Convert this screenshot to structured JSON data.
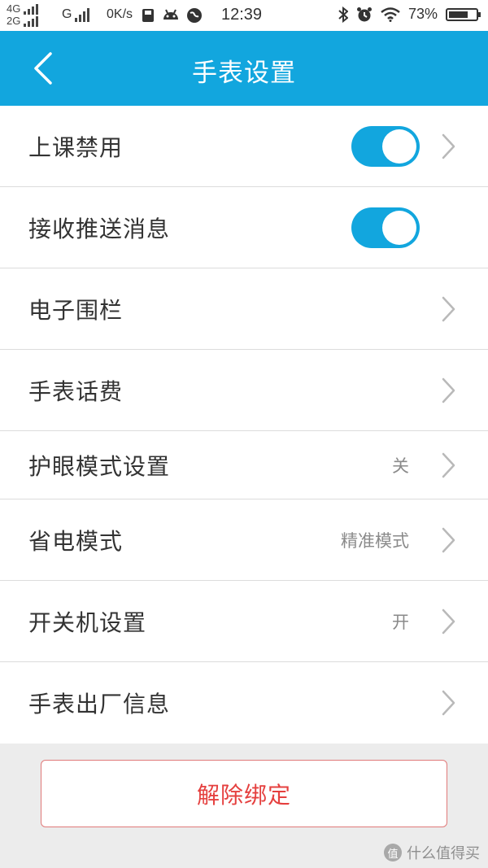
{
  "status_bar": {
    "network_1": "4G",
    "network_2": "2G",
    "network_3": "G",
    "speed": "0K/s",
    "time": "12:39",
    "battery_percent": "73%",
    "battery_level": 0.73,
    "icons": [
      "sim-icon",
      "android-icon",
      "globe-icon",
      "bluetooth-icon",
      "alarm-icon",
      "wifi-icon",
      "battery-icon"
    ]
  },
  "header": {
    "title": "手表设置",
    "back_icon": "chevron-left-icon",
    "background": "#12a6de"
  },
  "settings": [
    {
      "label": "上课禁用",
      "toggle": true,
      "on": true,
      "value": "",
      "chevron": true
    },
    {
      "label": "接收推送消息",
      "toggle": true,
      "on": true,
      "value": "",
      "chevron": false
    },
    {
      "label": "电子围栏",
      "toggle": false,
      "value": "",
      "chevron": true
    },
    {
      "label": "手表话费",
      "toggle": false,
      "value": "",
      "chevron": true
    },
    {
      "label": "护眼模式设置",
      "toggle": false,
      "value": "关",
      "chevron": true
    },
    {
      "label": "省电模式",
      "toggle": false,
      "value": "精准模式",
      "chevron": true
    },
    {
      "label": "开关机设置",
      "toggle": false,
      "value": "开",
      "chevron": true
    },
    {
      "label": "手表出厂信息",
      "toggle": false,
      "value": "",
      "chevron": true
    }
  ],
  "unbind_button": {
    "label": "解除绑定",
    "color": "#e5403f"
  },
  "watermark": {
    "logo": "值",
    "text": "什么值得买"
  },
  "colors": {
    "accent": "#12a6de",
    "danger": "#e5403f"
  }
}
